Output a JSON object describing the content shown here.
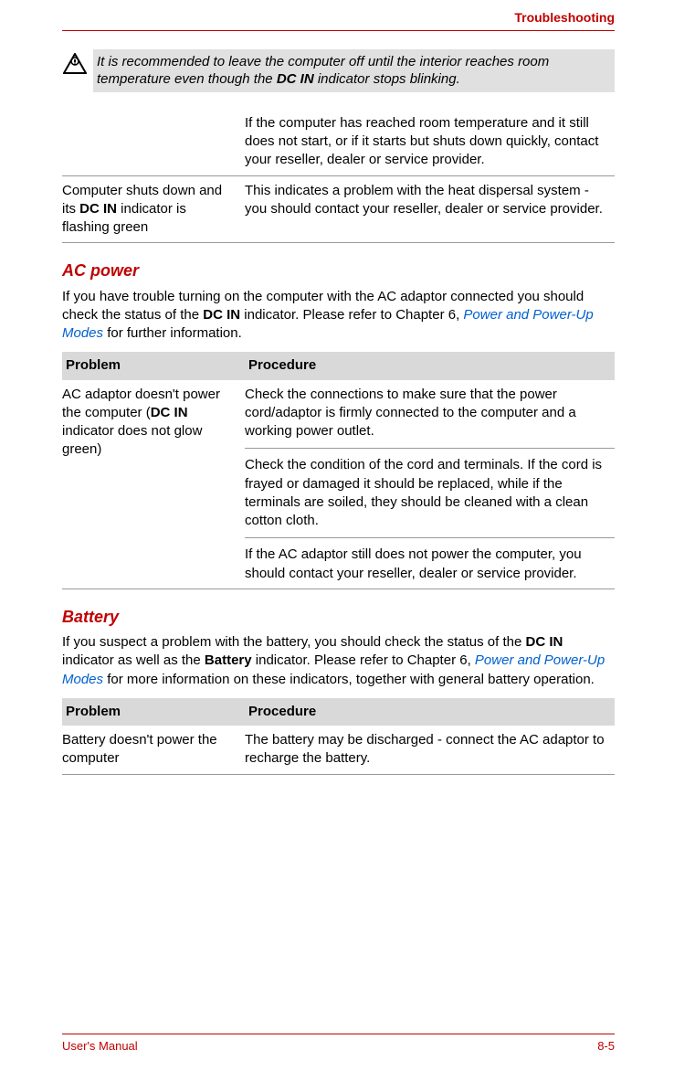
{
  "header_title": "Troubleshooting",
  "note": {
    "text_prefix": "It is recommended to leave the computer off until the interior reaches room temperature even though the ",
    "text_bold": "DC IN",
    "text_suffix": " indicator stops blinking."
  },
  "top_rows": [
    {
      "problem": "",
      "procedure": "If the computer has reached room temperature and it still does not start, or if it starts but shuts down quickly, contact your reseller, dealer or service provider."
    },
    {
      "problem_prefix": "Computer shuts down and its ",
      "problem_bold": "DC IN",
      "problem_suffix": " indicator is flashing green",
      "procedure": "This indicates a problem with the heat dispersal system - you should contact your reseller, dealer or service provider."
    }
  ],
  "ac_power": {
    "heading": "AC power",
    "intro_prefix": "If you have trouble turning on the computer with the AC adaptor connected you should check the status of the ",
    "intro_bold": "DC IN",
    "intro_mid": " indicator. Please refer to Chapter 6, ",
    "intro_link": "Power and Power-Up Modes",
    "intro_suffix": " for further information.",
    "table_header": {
      "problem": "Problem",
      "procedure": "Procedure"
    },
    "row_problem_prefix": "AC adaptor doesn't power the computer (",
    "row_problem_bold": "DC IN",
    "row_problem_suffix": " indicator does not glow green)",
    "procedures": [
      "Check the connections to make sure that the power cord/adaptor is firmly connected to the computer and a working power outlet.",
      "Check the condition of the cord and terminals. If the cord is frayed or damaged it should be replaced, while if the terminals are soiled, they should be cleaned with a clean cotton cloth.",
      "If the AC adaptor still does not power the computer, you should contact your reseller, dealer or service provider."
    ]
  },
  "battery": {
    "heading": "Battery",
    "intro_prefix": "If you suspect a problem with the battery, you should check the status of the ",
    "intro_bold1": "DC IN",
    "intro_mid1": " indicator as well as the ",
    "intro_bold2": "Battery",
    "intro_mid2": " indicator. Please refer to Chapter 6, ",
    "intro_link": "Power and Power-Up Modes",
    "intro_suffix": " for more information on these indicators, together with general battery operation.",
    "table_header": {
      "problem": "Problem",
      "procedure": "Procedure"
    },
    "row": {
      "problem": "Battery doesn't power the computer",
      "procedure": "The battery may be discharged - connect the AC adaptor to recharge the battery."
    }
  },
  "footer": {
    "left": "User's Manual",
    "right": "8-5"
  }
}
